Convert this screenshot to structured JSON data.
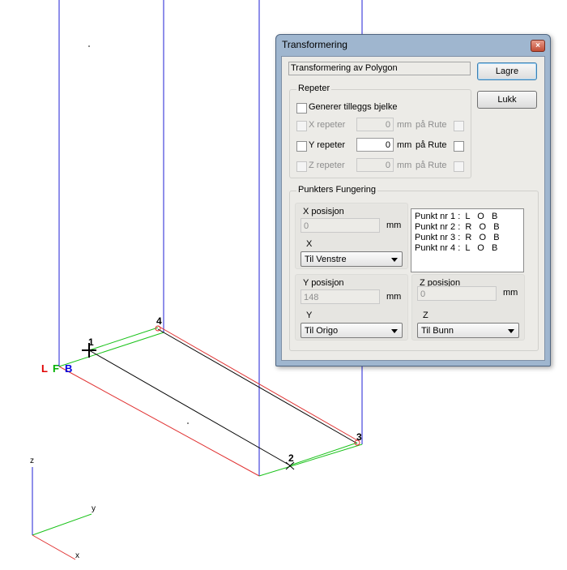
{
  "canvas": {
    "point_labels": [
      "1",
      "2",
      "3",
      "4"
    ],
    "lfb": {
      "l": "L",
      "f": "F",
      "b": "B",
      "l_color": "#e00000",
      "f_color": "#00b000",
      "b_color": "#0000e0"
    },
    "axes": {
      "z": "z",
      "y": "y",
      "x": "x"
    },
    "colors": {
      "red": "#e03030",
      "green": "#19c219",
      "blue": "#1f1fd6",
      "black": "#000000"
    }
  },
  "dialog": {
    "title": "Transformering",
    "close_glyph": "×",
    "mode": "Transformering av Polygon",
    "save_label": "Lagre",
    "close_label": "Lukk",
    "repeat": {
      "title": "Repeter",
      "generate_label": "Generer tilleggs bjelke",
      "unit": "mm",
      "grid_label": "på Rute",
      "x": {
        "label": "X repeter",
        "value": "0"
      },
      "y": {
        "label": "Y repeter",
        "value": "0"
      },
      "z": {
        "label": "Z repeter",
        "value": "0"
      }
    },
    "points": {
      "title": "Punkters Fungering",
      "x_pos_label": "X posisjon",
      "x_pos_value": "0",
      "x_axis": "X",
      "x_select": "Til Venstre",
      "y_pos_label": "Y posisjon",
      "y_pos_value": "148",
      "y_axis": "Y",
      "y_select": "Til Origo",
      "z_pos_label": "Z posisjon",
      "z_pos_value": "0",
      "z_axis": "Z",
      "z_select": "Til Bunn",
      "unit": "mm",
      "list": [
        "Punkt nr 1 :  L   O   B",
        "Punkt nr 2 :  R   O   B",
        "Punkt nr 3 :  R   O   B",
        "Punkt nr 4 :  L   O   B"
      ]
    }
  }
}
